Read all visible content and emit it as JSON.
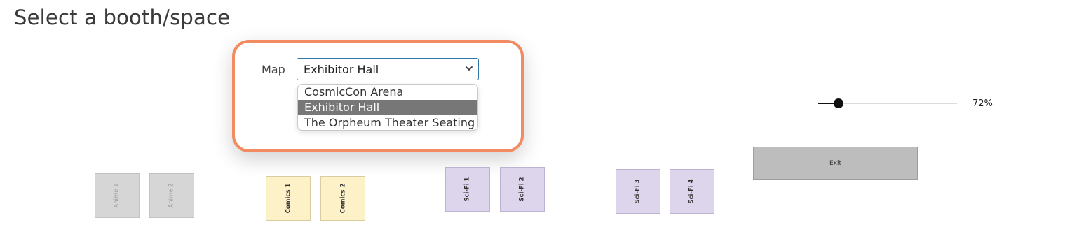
{
  "page": {
    "title": "Select a booth/space"
  },
  "map_selector": {
    "label": "Map",
    "selected": "Exhibitor Hall",
    "options": [
      {
        "label": "CosmicCon Arena"
      },
      {
        "label": "Exhibitor Hall",
        "selected": true
      },
      {
        "label": "The Orpheum Theater Seating"
      }
    ]
  },
  "zoom": {
    "value": 0.72,
    "label": "72%"
  },
  "floor": {
    "exit_label": "Exit",
    "booths": [
      {
        "label": "Anime 1",
        "category": "anime"
      },
      {
        "label": "Anime 2",
        "category": "anime"
      },
      {
        "label": "Comics 1",
        "category": "comics"
      },
      {
        "label": "Comics 2",
        "category": "comics"
      },
      {
        "label": "Sci-Fi 1",
        "category": "scifi"
      },
      {
        "label": "Sci-Fi 2",
        "category": "scifi"
      },
      {
        "label": "Sci-Fi 3",
        "category": "scifi"
      },
      {
        "label": "Sci-Fi 4",
        "category": "scifi"
      }
    ]
  },
  "colors": {
    "highlight_border": "#f28b62",
    "select_border": "#2f79a8",
    "selected_option_bg": "#777777",
    "anime_booth": "#d6d6d6",
    "comics_booth": "#fdf1c8",
    "scifi_booth": "#ddd5ec",
    "exit_area": "#bdbdbd"
  }
}
